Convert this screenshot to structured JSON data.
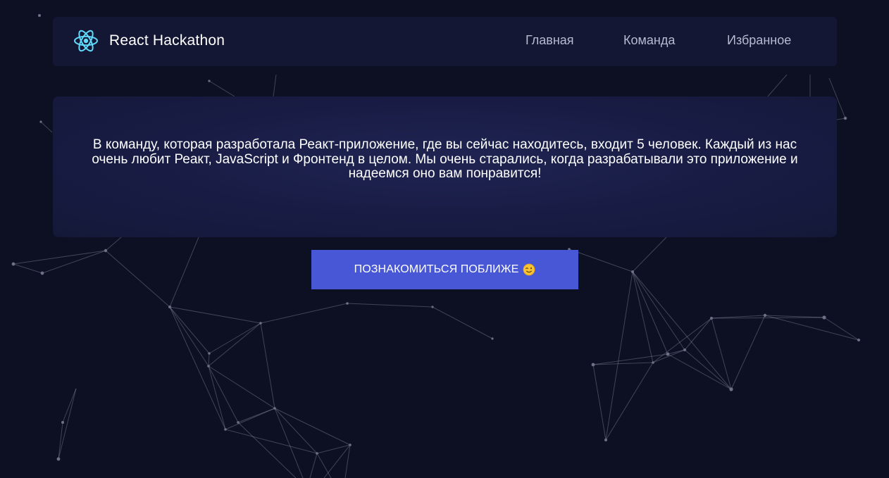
{
  "header": {
    "brand": "React Hackathon",
    "logo_icon": "react-atom-icon",
    "nav": [
      {
        "label": "Главная"
      },
      {
        "label": "Команда"
      },
      {
        "label": "Избранное"
      }
    ]
  },
  "hero": {
    "text": "В команду, которая разработала Реакт-приложение, где вы сейчас находитесь, входит 5 человек. Каждый из нас очень любит Реакт, JavaScript и Фронтенд в целом. Мы очень старались, когда разрабатывали это приложение и надеемся оно вам понравится!"
  },
  "cta": {
    "label": "ПОЗНАКОМИТЬСЯ ПОБЛИЖЕ",
    "icon": "winking-face-icon"
  },
  "colors": {
    "background": "#0d0f22",
    "panel": "#131734",
    "accent": "#4757d6",
    "logo": "#61dafb"
  }
}
